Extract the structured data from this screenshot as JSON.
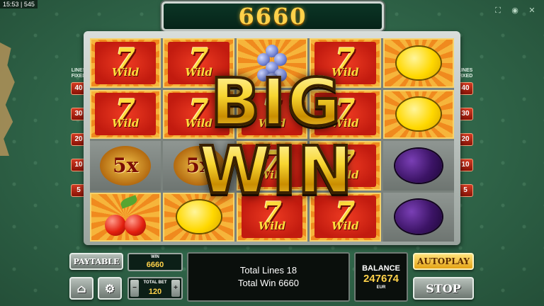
{
  "status_bar": {
    "text": "15:53 | 545"
  },
  "top_icons": [
    {
      "name": "fullscreen-icon",
      "glyph": "⛶"
    },
    {
      "name": "sound-icon",
      "glyph": "◉"
    },
    {
      "name": "close-icon",
      "glyph": "✕"
    }
  ],
  "win_display": {
    "value": "6660"
  },
  "lines_fixed": {
    "caption": "LINES FIXED",
    "values": [
      "40",
      "30",
      "20",
      "10",
      "5"
    ]
  },
  "reels": [
    [
      "seven",
      "seven",
      "grapes",
      "seven",
      "lemon"
    ],
    [
      "seven",
      "seven",
      "seven",
      "seven",
      "lemon"
    ],
    [
      "five_x",
      "five_x",
      "seven",
      "seven",
      "plum"
    ],
    [
      "cherries",
      "lemon",
      "seven",
      "seven",
      "plum"
    ]
  ],
  "reel_labels": {
    "wild": "Wild",
    "multiplier": "5x"
  },
  "big_win": {
    "line1": "BIG",
    "line2": "WIN"
  },
  "controls": {
    "paytable_label": "PAYTABLE",
    "autoplay_label": "AUTOPLAY",
    "stop_label": "STOP",
    "home_icon": "home-icon",
    "settings_icon": "gear-icon"
  },
  "win_box": {
    "label": "WIN",
    "value": "6660"
  },
  "bet": {
    "label": "TOTAL BET",
    "value": "120",
    "minus": "−",
    "plus": "+"
  },
  "message": {
    "line1": "Total Lines 18",
    "line2": "Total Win 6660"
  },
  "balance": {
    "label": "BALANCE",
    "value": "247674",
    "currency": "EUR"
  }
}
